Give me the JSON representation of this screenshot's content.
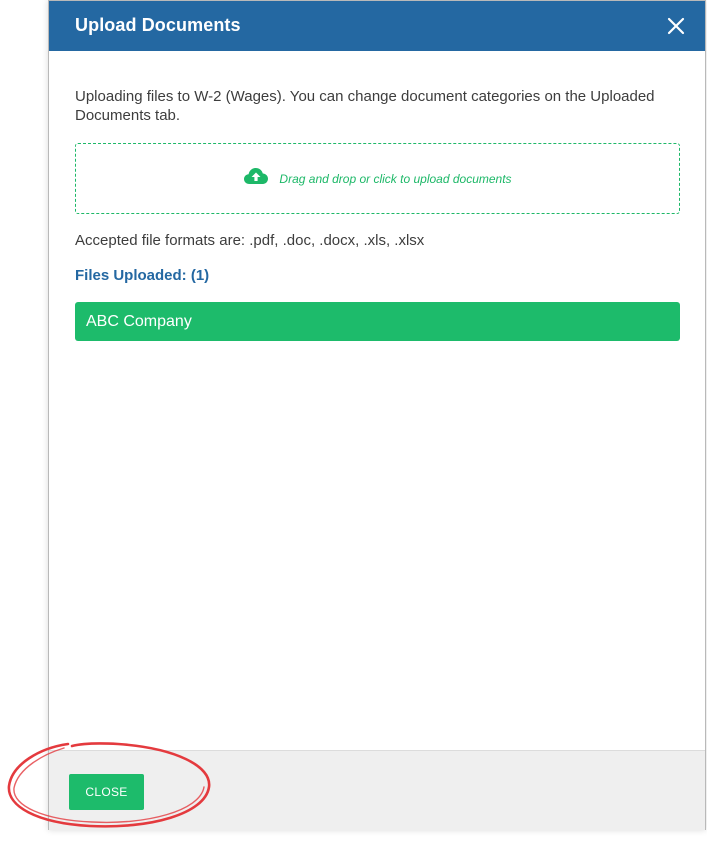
{
  "modal": {
    "title": "Upload Documents",
    "intro_text": "Uploading files to W-2 (Wages). You can change document categories on the Uploaded Documents tab.",
    "dropzone_text": "Drag and drop or click to upload documents",
    "dropzone_icon": "cloud-upload-icon",
    "close_icon": "close-icon",
    "formats_text": "Accepted file formats are: .pdf, .doc, .docx, .xls, .xlsx",
    "files_heading": "Files Uploaded: (1)",
    "files": [
      {
        "name": "ABC Company"
      }
    ],
    "footer": {
      "close_label": "CLOSE"
    }
  },
  "colors": {
    "header_bg": "#2468a2",
    "accent_green": "#1dbb6b",
    "annotation_red": "#e43a3e",
    "footer_bg": "#efefef"
  }
}
